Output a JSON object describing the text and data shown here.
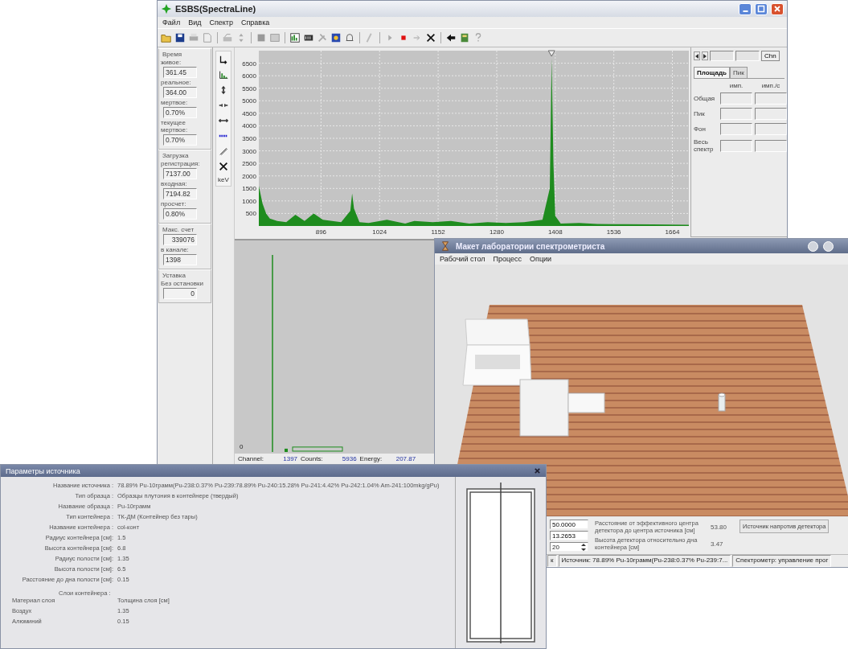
{
  "main_window": {
    "title": "ESBS(SpectraLine)",
    "menu": [
      "Файл",
      "Вид",
      "Спектр",
      "Справка"
    ],
    "left_panel": [
      {
        "title": "Время",
        "fields": [
          {
            "label": "живое:",
            "value": "361.45"
          },
          {
            "label": "реальное:",
            "value": "364.00"
          },
          {
            "label": "мертвое:",
            "value": "0.70%"
          },
          {
            "label": "текущее мертвое:",
            "value": "0.70%"
          }
        ]
      },
      {
        "title": "Загрузка",
        "fields": [
          {
            "label": "регистрация:",
            "value": "7137.00"
          },
          {
            "label": "входная:",
            "value": "7194.82"
          },
          {
            "label": "просчет:",
            "value": "0.80%"
          }
        ]
      },
      {
        "title": "Макс. счет",
        "fields": [
          {
            "value": "339076"
          },
          {
            "label": "в канале:",
            "value": "1398"
          }
        ]
      },
      {
        "title": "Уставка",
        "note": "Без остановки",
        "fields": [
          {
            "value": "0"
          }
        ]
      }
    ],
    "unit_button": "keV",
    "spectrum": {
      "chart_data": {
        "type": "area",
        "grid": true,
        "xlim": [
          760,
          1700
        ],
        "ylim": [
          0,
          7000
        ],
        "xticks": [
          896,
          1024,
          1152,
          1280,
          1408,
          1536,
          1664
        ],
        "yticks": [
          500,
          1000,
          1500,
          2000,
          2500,
          3000,
          3500,
          4000,
          4500,
          5000,
          5500,
          6000,
          6500
        ],
        "x": [
          760,
          768,
          776,
          784,
          792,
          800,
          820,
          840,
          860,
          880,
          900,
          920,
          940,
          960,
          964,
          968,
          980,
          1000,
          1040,
          1080,
          1100,
          1140,
          1180,
          1220,
          1260,
          1300,
          1340,
          1380,
          1396,
          1400,
          1404,
          1408,
          1420,
          1460,
          1500,
          1560,
          1620,
          1700
        ],
        "series": [
          {
            "color": "#1e8c1e",
            "values": [
              1600,
              900,
              500,
              300,
              250,
              200,
              150,
              450,
              200,
              500,
              250,
              200,
              150,
              600,
              1300,
              700,
              150,
              120,
              250,
              100,
              200,
              150,
              200,
              100,
              150,
              120,
              150,
              250,
              1500,
              6700,
              2500,
              400,
              100,
              120,
              80,
              70,
              60,
              50
            ]
          }
        ]
      }
    },
    "right_panel": {
      "channel_button": "Chn",
      "tabs": [
        {
          "label": "Площадь",
          "selected": true
        },
        {
          "label": "Пик",
          "selected": false
        }
      ],
      "columns": [
        "имп.",
        "имп./с"
      ],
      "rows": [
        "Общая",
        "Пик",
        "Фон",
        "Весь спектр"
      ]
    },
    "channel_plot": {
      "axis_label": "0",
      "status": [
        {
          "label": "Channel:",
          "value": "1397"
        },
        {
          "label": "Counts:",
          "value": "5936"
        },
        {
          "label": "Energy:",
          "value": "207.87"
        }
      ]
    }
  },
  "lab_window": {
    "title": "Макет лаборатории спектрометриста",
    "menu": [
      "Рабочий стол",
      "Процесс",
      "Опции"
    ],
    "fields": [
      "50.0000",
      "13.2653"
    ],
    "spinner": "20",
    "readouts": [
      {
        "label": "Расстояние от эффективного центра детектора до центра источника [см]",
        "value": "53.80"
      },
      {
        "label": "Высота детектора относительно дна контейнера [см]",
        "value": "3.47"
      }
    ],
    "button": "Источник напротив детектора",
    "status": [
      "к",
      "Источник: 78.89% Pu-10грамм(Pu-238:0.37% Pu-239:7...",
      "Спектрометр: управление прог"
    ]
  },
  "source_dialog": {
    "title": "Параметры источника",
    "params": [
      {
        "label": "Название источника :",
        "value": "78.89% Pu-10грамм(Pu-238:0.37% Pu-239:78.89% Pu-240:15.28% Pu-241:4.42% Pu-242:1.04% Am-241:100mkg/gPu)"
      },
      {
        "label": "Тип образца :",
        "value": "Образцы плутония в контейнере (твердый)"
      },
      {
        "label": "Название образца :",
        "value": "Pu-10грамм"
      },
      {
        "label": "Тип контейнера :",
        "value": "ТК-ДМ (Контейнер без тары)"
      },
      {
        "label": "Название контейнера :",
        "value": "col-конт"
      },
      {
        "label": "Радиус контейнера [см]:",
        "value": "1.5"
      },
      {
        "label": "Высота контейнера [см]:",
        "value": "6.8"
      },
      {
        "label": "Радиус полости [см]:",
        "value": "1.35"
      },
      {
        "label": "Высота полости [см]:",
        "value": "6.5"
      },
      {
        "label": "Расстояние до дна полости [см]:",
        "value": "0.15"
      }
    ],
    "layers_title": "Слои контейнера :",
    "layer_columns": [
      "Материал слоя",
      "Толщина слоя [см]"
    ],
    "layers": [
      {
        "material": "Воздух",
        "thickness": "1.35"
      },
      {
        "material": "Алюминий",
        "thickness": "0.15"
      }
    ]
  }
}
